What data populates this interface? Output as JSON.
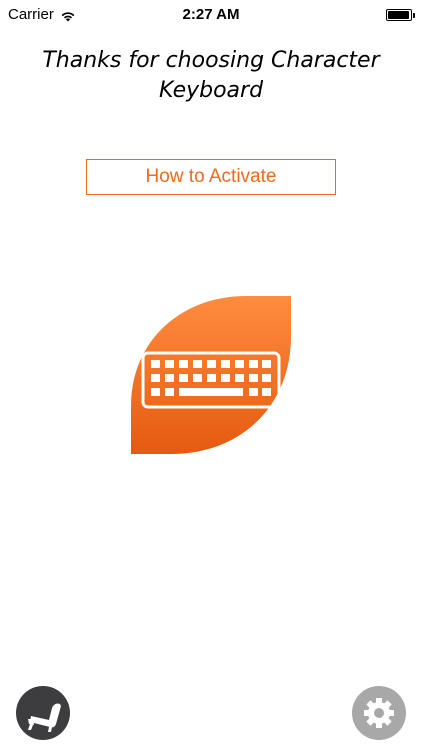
{
  "status_bar": {
    "carrier": "Carrier",
    "time": "2:27 AM"
  },
  "header": {
    "title": "Thanks for choosing Character Keyboard"
  },
  "main": {
    "activate_button_label": "How to Activate",
    "logo_icon": "keyboard-icon"
  },
  "footer": {
    "left_icon": "armchair-icon",
    "right_icon": "gear-icon"
  },
  "colors": {
    "accent": "#f06a1d",
    "logo_gradient_top": "#ff8a3d",
    "logo_gradient_bottom": "#e85a12",
    "footer_left_bg": "#3d3d3f",
    "footer_right_bg": "#a8a8a8"
  }
}
